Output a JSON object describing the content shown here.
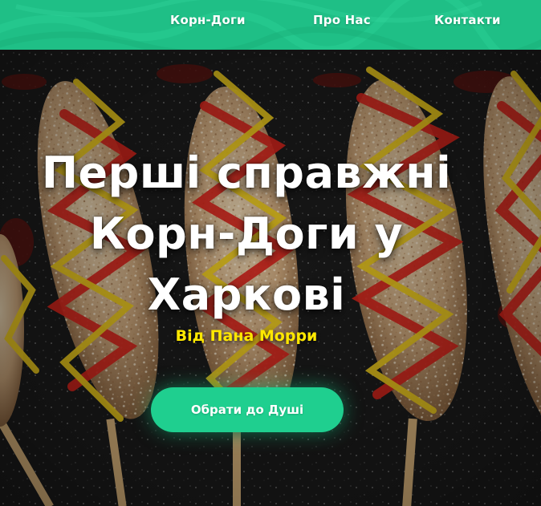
{
  "nav": {
    "items": [
      {
        "label": "Корн-Доги"
      },
      {
        "label": "Про Нас"
      },
      {
        "label": "Контакти"
      }
    ]
  },
  "hero": {
    "title_line1": "Перші справжні",
    "title_line2": "Корн-Доги у",
    "title_line3": "Харкові",
    "subtitle": "Від Пана Морри",
    "cta_label": "Обрати до Душі"
  },
  "colors": {
    "brand_green": "#1fbf86",
    "accent_yellow": "#ffe800",
    "ketchup_red": "#d4241b",
    "mustard": "#e7c51c"
  }
}
